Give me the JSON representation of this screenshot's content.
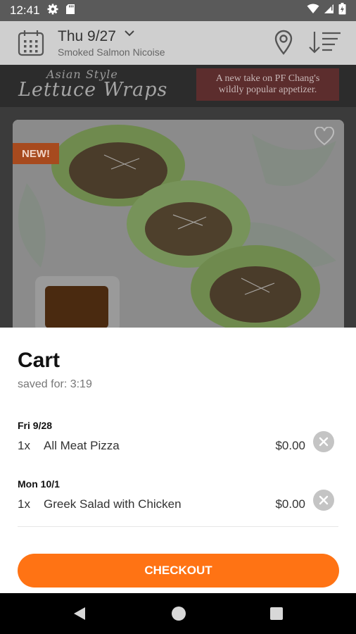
{
  "status_bar": {
    "time": "12:41"
  },
  "header": {
    "date_label": "Thu 9/27",
    "menu_item": "Smoked Salmon Nicoise"
  },
  "banner": {
    "title_small": "Asian Style",
    "title_large": "Lettuce Wraps",
    "tagline_line1": "A new take on PF Chang's",
    "tagline_line2": "wildly popular appetizer."
  },
  "featured": {
    "badge": "NEW!"
  },
  "cart": {
    "title": "Cart",
    "saved_for": "saved for: 3:19",
    "groups": [
      {
        "date": "Fri 9/28",
        "items": [
          {
            "qty": "1x",
            "name": "All Meat Pizza",
            "price": "$0.00"
          }
        ]
      },
      {
        "date": "Mon 10/1",
        "items": [
          {
            "qty": "1x",
            "name": "Greek Salad with Chicken",
            "price": "$0.00"
          }
        ]
      }
    ],
    "checkout_label": "CHECKOUT"
  },
  "colors": {
    "accent": "#ff7314",
    "new_badge": "#a74a1e",
    "header_bg": "#cfcfcf"
  },
  "icons": [
    "settings-icon",
    "sd-card-icon",
    "wifi-icon",
    "signal-icon",
    "battery-icon",
    "calendar-icon",
    "chevron-down-icon",
    "location-pin-icon",
    "sort-icon",
    "heart-icon",
    "close-icon",
    "back-icon",
    "home-icon",
    "recents-icon"
  ]
}
